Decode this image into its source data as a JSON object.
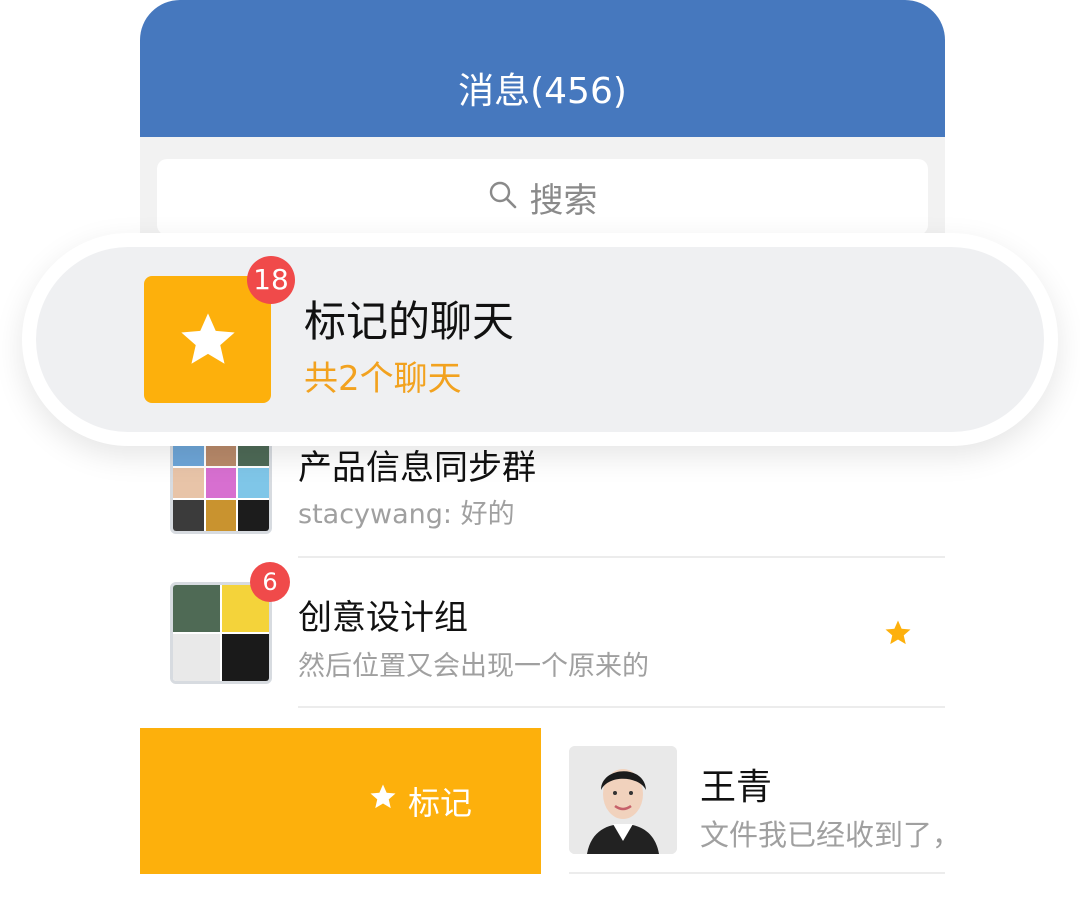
{
  "header": {
    "title": "消息(456)"
  },
  "search": {
    "placeholder": "搜索"
  },
  "highlight": {
    "title": "标记的聊天",
    "subtitle": "共2个聊天",
    "badge": "18"
  },
  "chats": [
    {
      "name": "产品信息同步群",
      "preview": "stacywang: 好的",
      "badge": "",
      "starred": false
    },
    {
      "name": "创意设计组",
      "preview": "然后位置又会出现一个原来的",
      "badge": "6",
      "starred": true
    }
  ],
  "swipe_action": {
    "label": "标记"
  },
  "person": {
    "name": "王青",
    "preview": "文件我已经收到了，"
  },
  "colors": {
    "header_blue": "#4678be",
    "accent_yellow": "#fdb00c",
    "badge_red": "#f04a4a",
    "subtitle_orange": "#f2a21f"
  },
  "icons": [
    "search-icon",
    "star-icon"
  ]
}
